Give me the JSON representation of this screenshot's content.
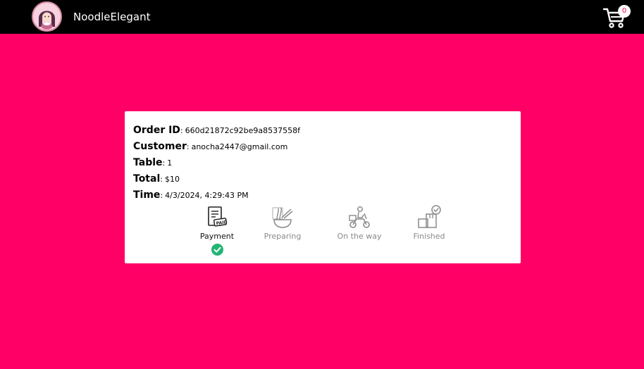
{
  "header": {
    "brand": "NoodleElegant",
    "cart_count": "0",
    "avatar_icon": "noodle-girl-avatar-icon",
    "cart_icon": "shopping-cart-icon"
  },
  "order": {
    "fields": [
      {
        "label": "Order ID",
        "value": "660d21872c92be9a8537558f"
      },
      {
        "label": "Customer",
        "value": "anocha2447@gmail.com"
      },
      {
        "label": "Table",
        "value": "1"
      },
      {
        "label": "Total",
        "value": "$10"
      },
      {
        "label": "Time",
        "value": "4/3/2024, 4:29:43 PM"
      }
    ]
  },
  "status_steps": [
    {
      "label": "Payment",
      "icon": "paid-receipt-icon",
      "active": true
    },
    {
      "label": "Preparing",
      "icon": "noodle-bowl-icon",
      "active": false
    },
    {
      "label": "On the way",
      "icon": "delivery-scooter-icon",
      "active": false
    },
    {
      "label": "Finished",
      "icon": "delivered-boxes-icon",
      "active": false
    }
  ],
  "colors": {
    "background": "#ff0066",
    "header": "#000000",
    "check": "#21b573"
  }
}
